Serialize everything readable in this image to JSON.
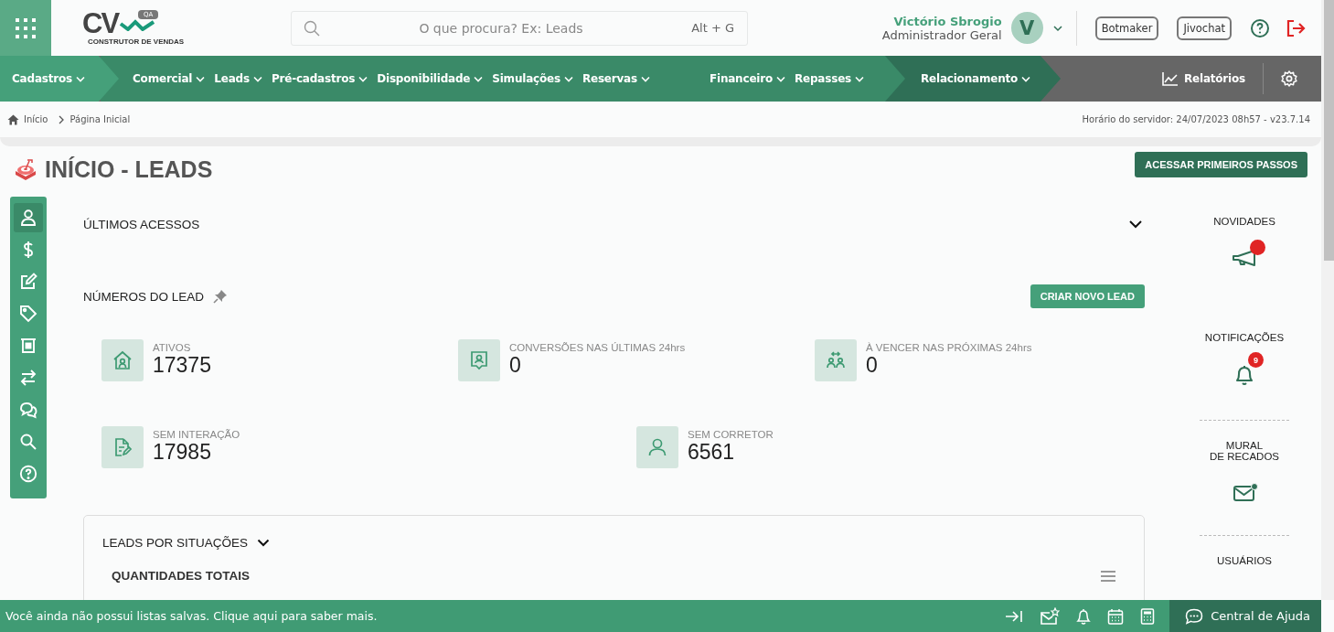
{
  "header": {
    "logo": {
      "letters": "CV",
      "badge": "QA",
      "tagline": "CONSTRUTOR DE VENDAS"
    },
    "search": {
      "placeholder": "O que procura? Ex: Leads",
      "shortcut": "Alt + G"
    },
    "user": {
      "name": "Victório Sbrogio",
      "role": "Administrador Geral",
      "initial": "V"
    },
    "buttons": [
      "Botmaker",
      "Jivochat"
    ]
  },
  "nav": {
    "segments": [
      {
        "kind": "light",
        "groups": [
          [
            "Cadastros"
          ]
        ]
      },
      {
        "kind": "mid",
        "groups": [
          [
            "Comercial",
            "Leads",
            "Pré-cadastros",
            "Disponibilidade",
            "Simulações",
            "Reservas"
          ],
          [
            "Financeiro",
            "Repasses"
          ]
        ]
      },
      {
        "kind": "dark",
        "groups": [
          [
            "Relacionamento"
          ]
        ]
      }
    ],
    "reports": "Relatórios"
  },
  "breadcrumb": {
    "items": [
      "Início",
      "Página Inicial"
    ],
    "server_time": "Horário do servidor: 24/07/2023 08h57 - v23.7.14"
  },
  "page": {
    "title": "INÍCIO - LEADS",
    "action": "ACESSAR PRIMEIROS PASSOS"
  },
  "side_tools": [
    {
      "kind": "person",
      "selected": true
    },
    {
      "kind": "dollar",
      "selected": false
    },
    {
      "kind": "edit",
      "selected": false
    },
    {
      "kind": "tag",
      "selected": false
    },
    {
      "kind": "register",
      "selected": false
    },
    {
      "kind": "transfer",
      "selected": false
    },
    {
      "kind": "chat",
      "selected": false
    },
    {
      "kind": "search",
      "selected": false
    },
    {
      "kind": "help",
      "selected": false
    }
  ],
  "recent": {
    "title": "ÚLTIMOS ACESSOS",
    "expanded": false
  },
  "lead_numbers": {
    "title": "NÚMEROS DO LEAD",
    "action": "CRIAR NOVO LEAD",
    "rows": [
      [
        {
          "kind": "house",
          "label": "ATIVOS",
          "value": "17375"
        },
        {
          "kind": "badge",
          "label": "CONVERSÕES NAS ÚLTIMAS 24hrs",
          "value": "0"
        },
        {
          "kind": "swap",
          "label": "À VENCER NAS PRÓXIMAS 24hrs",
          "value": "0"
        }
      ],
      [
        {
          "kind": "document",
          "label": "SEM INTERAÇÃO",
          "value": "17985"
        },
        {
          "kind": "person",
          "label": "SEM CORRETOR",
          "value": "6561"
        }
      ]
    ]
  },
  "situations": {
    "title": "LEADS POR SITUAÇÕES",
    "subtitle": "QUANTIDADES TOTAIS"
  },
  "right_panel": [
    {
      "kind": "news",
      "title": "NOVIDADES",
      "dot": true
    },
    {
      "kind": "notifications",
      "title": "NOTIFICAÇÕES",
      "count": "9"
    },
    {
      "kind": "mural",
      "title": "MURAL\nDE RECADOS",
      "dot": true
    },
    {
      "kind": "users",
      "title": "USUÁRIOS"
    }
  ],
  "footer": {
    "message": "Você ainda não possui listas salvas. Clique aqui para saber mais.",
    "help": "Central de Ajuda"
  }
}
